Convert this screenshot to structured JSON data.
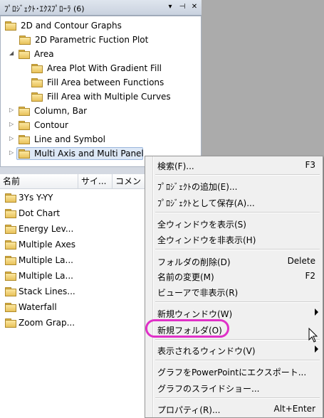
{
  "panel": {
    "title": "ﾌﾟﾛｼﾞｪｸﾄ･ｴｸｽﾌﾟﾛｰﾗ (6)",
    "controls": [
      "▾",
      "⊣",
      "✕"
    ]
  },
  "tree": [
    {
      "label": "2D and Contour Graphs",
      "expander": ""
    },
    {
      "label": "2D Parametric Fuction Plot",
      "expander": ""
    },
    {
      "label": "Area",
      "expander": "◢"
    },
    {
      "label": "Area Plot With Gradient Fill",
      "expander": ""
    },
    {
      "label": "Fill Area between Functions",
      "expander": ""
    },
    {
      "label": "Fill Area with Multiple Curves",
      "expander": ""
    },
    {
      "label": "Column, Bar",
      "expander": "▷"
    },
    {
      "label": "Contour",
      "expander": "▷"
    },
    {
      "label": "Line and Symbol",
      "expander": "▷"
    },
    {
      "label": "Multi Axis and Multi Panel",
      "expander": "▷"
    }
  ],
  "list": {
    "headers": [
      "名前",
      "サイ...",
      "コメン"
    ],
    "rows": [
      "3Ys Y-YY",
      "Dot Chart",
      "Energy Lev...",
      "Multiple Axes",
      "Multiple La...",
      "Multiple La...",
      "Stack Lines...",
      "Waterfall",
      "Zoom Grap..."
    ]
  },
  "menu": {
    "search": "検索(F)...",
    "search_sc": "F3",
    "add_project": "ﾌﾟﾛｼﾞｪｸﾄの追加(E)...",
    "save_as_project": "ﾌﾟﾛｼﾞｪｸﾄとして保存(A)...",
    "show_all": "全ウィンドウを表示(S)",
    "hide_all": "全ウィンドウを非表示(H)",
    "delete_folder": "フォルダの削除(D)",
    "delete_sc": "Delete",
    "rename": "名前の変更(M)",
    "rename_sc": "F2",
    "hide_in_viewer": "ビューアで非表示(R)",
    "new_window": "新規ウィンドウ(W)",
    "new_folder": "新規フォルダ(O)",
    "shown_windows": "表示されるウィンドウ(V)",
    "export_ppt": "グラフをPowerPointにエクスポート...",
    "slideshow": "グラフのスライドショー...",
    "properties": "プロパティ(R)...",
    "properties_sc": "Alt+Enter"
  },
  "colors": {
    "highlight_ring": "#e030c8"
  }
}
